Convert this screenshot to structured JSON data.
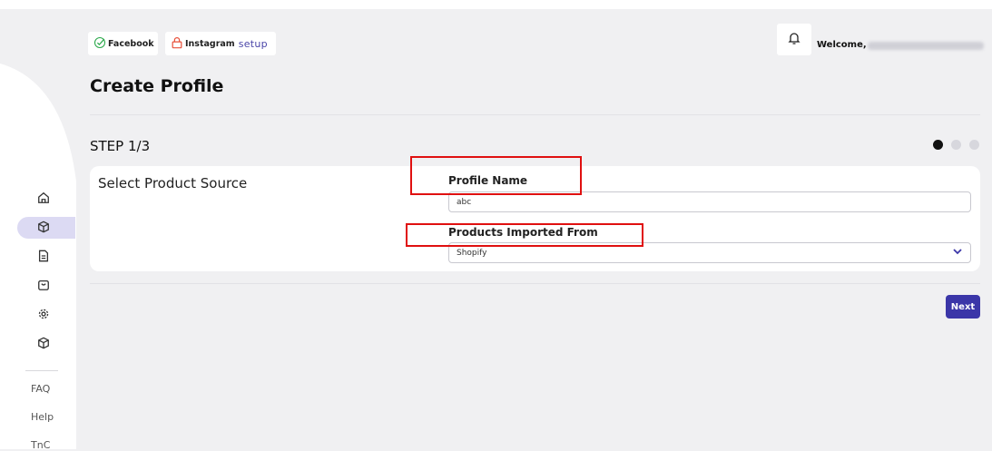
{
  "header": {
    "channels": [
      {
        "label": "Facebook",
        "status": "connected",
        "icon": "check-circle-icon",
        "color": "#2aa84a"
      },
      {
        "label": "Instagram",
        "status": "not-connected",
        "icon": "lock-icon",
        "color": "#e8503a",
        "action": "setup"
      }
    ],
    "welcome_text": "Welcome,"
  },
  "page": {
    "title": "Create Profile",
    "step_label": "STEP 1/3",
    "steps_total": 3,
    "current_step": 1
  },
  "form": {
    "section_title": "Select Product Source",
    "profile_name": {
      "label": "Profile Name",
      "value": "abc"
    },
    "products_imported_from": {
      "label": "Products Imported From",
      "value": "Shopify"
    }
  },
  "actions": {
    "next_label": "Next"
  },
  "sidebar": {
    "icons": [
      "home-icon",
      "box-icon",
      "document-icon",
      "bag-icon",
      "settings-icon",
      "box-icon"
    ],
    "active_index": 1,
    "links": [
      "FAQ",
      "Help",
      "TnC"
    ]
  },
  "colors": {
    "accent": "#3b36a8",
    "highlight": "#e01010",
    "active_nav": "#dcdaf3"
  }
}
